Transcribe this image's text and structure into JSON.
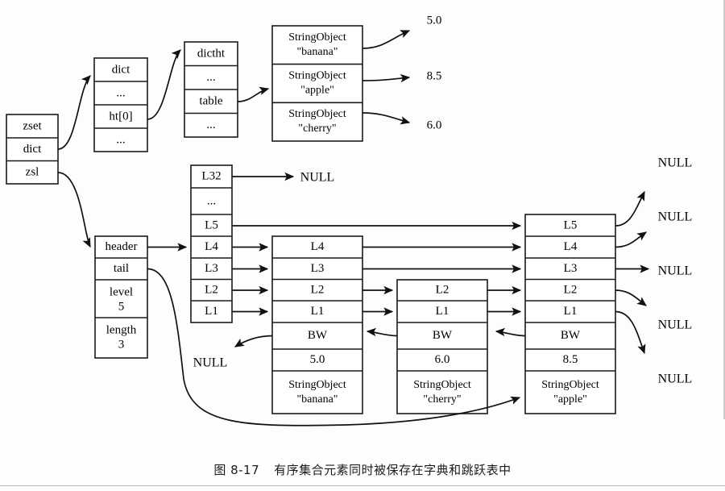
{
  "figure": {
    "caption_number": "图 8-17",
    "caption_text": "有序集合元素同时被保存在字典和跳跃表中",
    "ink_color": "#111111",
    "background_color": "#fdfdfd"
  },
  "zset_struct": {
    "name": "zset",
    "fields": [
      "zset",
      "dict",
      "zsl"
    ]
  },
  "dict_struct": {
    "name": "dict",
    "fields": [
      "dict",
      "...",
      "ht[0]",
      "..."
    ]
  },
  "dictht_struct": {
    "name": "dictht",
    "fields": [
      "dictht",
      "...",
      "table",
      "..."
    ]
  },
  "dict_entries": {
    "rows": [
      {
        "type": "StringObject",
        "member": "\"banana\"",
        "score": "5.0"
      },
      {
        "type": "StringObject",
        "member": "\"apple\"",
        "score": "8.5"
      },
      {
        "type": "StringObject",
        "member": "\"cherry\"",
        "score": "6.0"
      }
    ]
  },
  "zskiplist_struct": {
    "fields": [
      {
        "label": "header",
        "value": ""
      },
      {
        "label": "tail",
        "value": ""
      },
      {
        "label": "level",
        "value": "5"
      },
      {
        "label": "length",
        "value": "3"
      }
    ]
  },
  "skiplist_header_node": {
    "levels": [
      "L32",
      "...",
      "L5",
      "L4",
      "L3",
      "L2",
      "L1"
    ],
    "forward_null_label": "NULL",
    "backward_null_label": "NULL"
  },
  "skiplist_nodes": [
    {
      "id": "banana",
      "levels": [
        "L4",
        "L3",
        "L2",
        "L1"
      ],
      "backward_label": "BW",
      "score": "5.0",
      "object_type": "StringObject",
      "member": "\"banana\""
    },
    {
      "id": "cherry",
      "levels": [
        "L2",
        "L1"
      ],
      "backward_label": "BW",
      "score": "6.0",
      "object_type": "StringObject",
      "member": "\"cherry\""
    },
    {
      "id": "apple",
      "levels": [
        "L5",
        "L4",
        "L3",
        "L2",
        "L1"
      ],
      "backward_label": "BW",
      "score": "8.5",
      "object_type": "StringObject",
      "member": "\"apple\""
    }
  ],
  "null_terminators": {
    "right_side": [
      "NULL",
      "NULL",
      "NULL",
      "NULL",
      "NULL"
    ],
    "header_l32": "NULL",
    "backward_head": "NULL"
  }
}
